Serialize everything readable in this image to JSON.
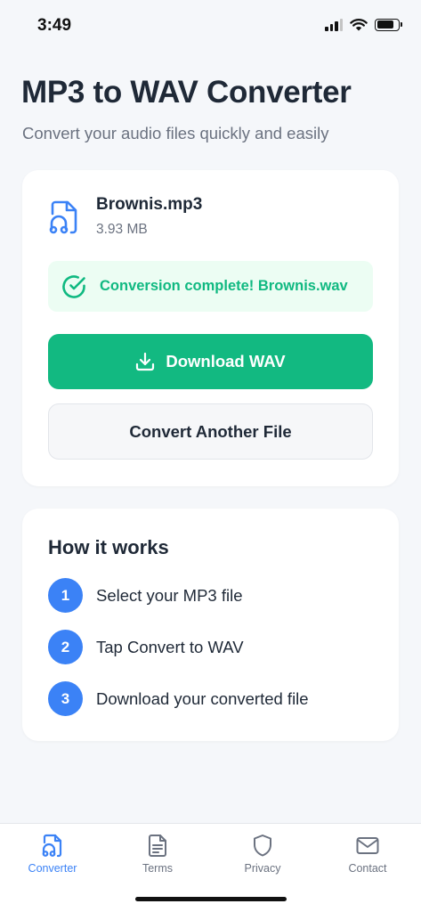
{
  "status_bar": {
    "time": "3:49"
  },
  "header": {
    "title": "MP3 to WAV Converter",
    "subtitle": "Convert your audio files quickly and easily"
  },
  "file": {
    "name": "Brownis.mp3",
    "size": "3.93 MB",
    "icon": "audio-file-icon"
  },
  "conversion": {
    "status_text": "Conversion complete! Brownis.wav",
    "icon": "check-circle-icon"
  },
  "actions": {
    "download_label": "Download WAV",
    "download_icon": "download-icon",
    "convert_another_label": "Convert Another File"
  },
  "how_it_works": {
    "title": "How it works",
    "steps": [
      {
        "number": "1",
        "text": "Select your MP3 file"
      },
      {
        "number": "2",
        "text": "Tap Convert to WAV"
      },
      {
        "number": "3",
        "text": "Download your converted file"
      }
    ]
  },
  "tab_bar": {
    "tabs": [
      {
        "label": "Converter",
        "icon": "headphones-file-icon",
        "active": true
      },
      {
        "label": "Terms",
        "icon": "document-icon",
        "active": false
      },
      {
        "label": "Privacy",
        "icon": "shield-icon",
        "active": false
      },
      {
        "label": "Contact",
        "icon": "mail-icon",
        "active": false
      }
    ]
  },
  "colors": {
    "accent_green": "#12b981",
    "accent_blue": "#3b82f6",
    "success_bg": "#ecfdf3",
    "background": "#f5f7fa"
  }
}
